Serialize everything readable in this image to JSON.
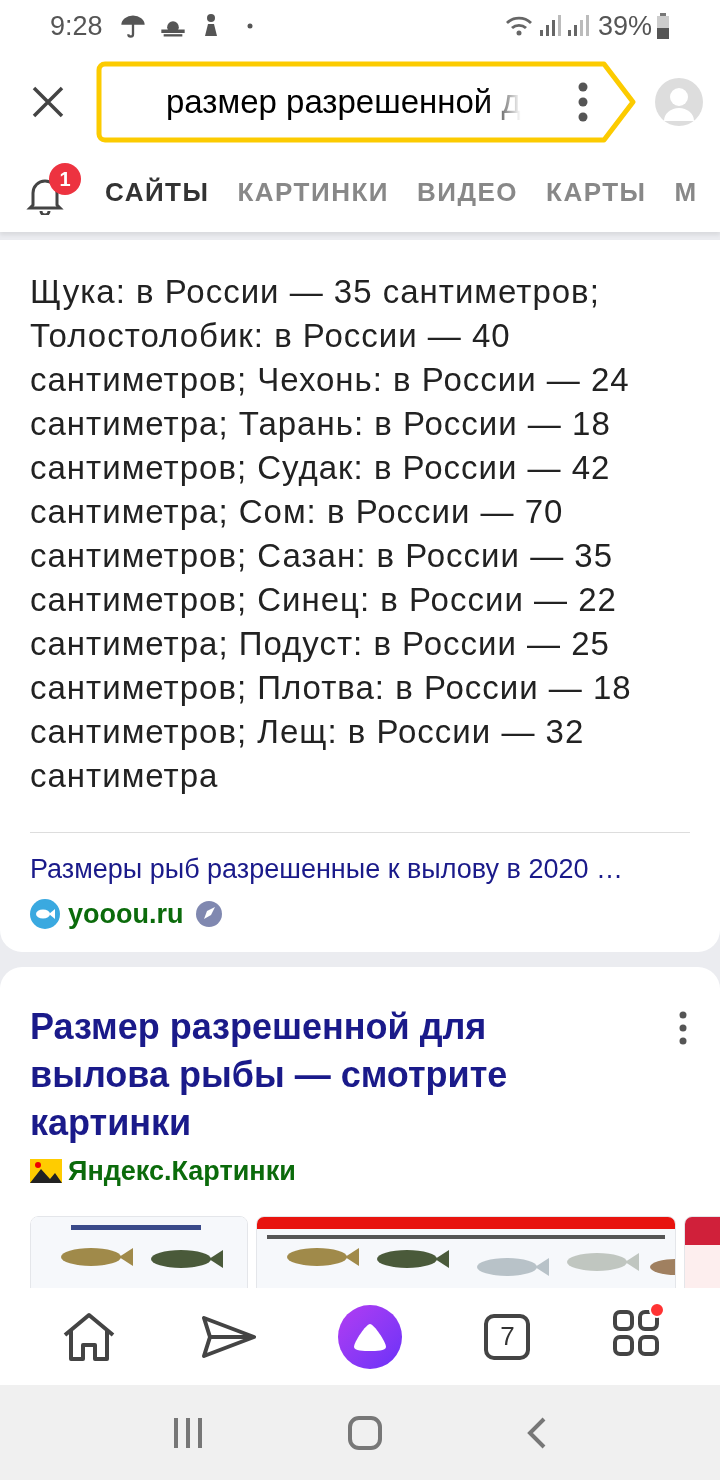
{
  "status_bar": {
    "time": "9:28",
    "battery": "39%"
  },
  "search": {
    "value": "размер разрешенной д"
  },
  "notifications": {
    "count": "1"
  },
  "tabs": [
    {
      "label": "САЙТЫ",
      "selected": true
    },
    {
      "label": "КАРТИНКИ",
      "selected": false
    },
    {
      "label": "ВИДЕО",
      "selected": false
    },
    {
      "label": "КАРТЫ",
      "selected": false
    },
    {
      "label": "М",
      "selected": false
    }
  ],
  "answer": {
    "text": "Щука: в России — 35 сантиметров; Толостолобик: в России — 40 сантиметров; Чехонь: в России — 24 сантиметра; Тарань: в России — 18 сантиметров; Судак: в России — 42 сантиметра; Сом: в России — 70 сантиметров; Сазан: в России — 35 сантиметров; Синец: в России — 22 сантиметра; Подуст: в России — 25 сантиметров; Плотва: в России — 18 сантиметров; Лещ: в России — 32 сантиметра",
    "source_title": "Размеры рыб разрешенные к вылову в 2020 …",
    "source_site": "yooou.ru"
  },
  "images_result": {
    "title": "Размер разрешенной для вылова рыбы — смотрите картинки",
    "source": "Яндекс.Картинки"
  },
  "bottom_nav": {
    "tabs_count": "7",
    "apps_badge": true
  }
}
